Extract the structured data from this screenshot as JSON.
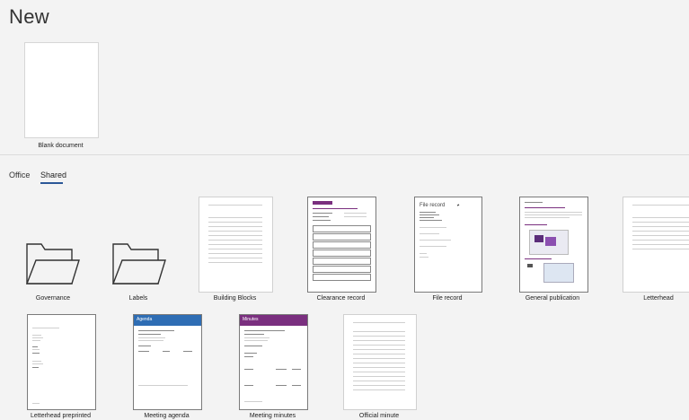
{
  "page": {
    "title": "New"
  },
  "blank": {
    "label": "Blank document"
  },
  "tabs": [
    {
      "label": "Office",
      "active": false
    },
    {
      "label": "Shared",
      "active": true
    }
  ],
  "templates": [
    {
      "label": "Governance",
      "kind": "folder"
    },
    {
      "label": "Labels",
      "kind": "folder"
    },
    {
      "label": "Building Blocks",
      "kind": "doc"
    },
    {
      "label": "Clearance record",
      "kind": "doc"
    },
    {
      "label": "File record",
      "kind": "doc",
      "heading": "File record"
    },
    {
      "label": "General publication",
      "kind": "doc"
    },
    {
      "label": "Letterhead",
      "kind": "doc"
    },
    {
      "label": "Letterhead preprinted",
      "kind": "doc"
    },
    {
      "label": "Meeting agenda",
      "kind": "doc",
      "heading": "Agenda"
    },
    {
      "label": "Meeting minutes",
      "kind": "doc",
      "heading": "Minutes"
    },
    {
      "label": "Official minute",
      "kind": "doc"
    }
  ],
  "colors": {
    "accent": "#2b5797",
    "agenda_banner": "#2e6db4",
    "minutes_banner": "#7a2f7f"
  }
}
